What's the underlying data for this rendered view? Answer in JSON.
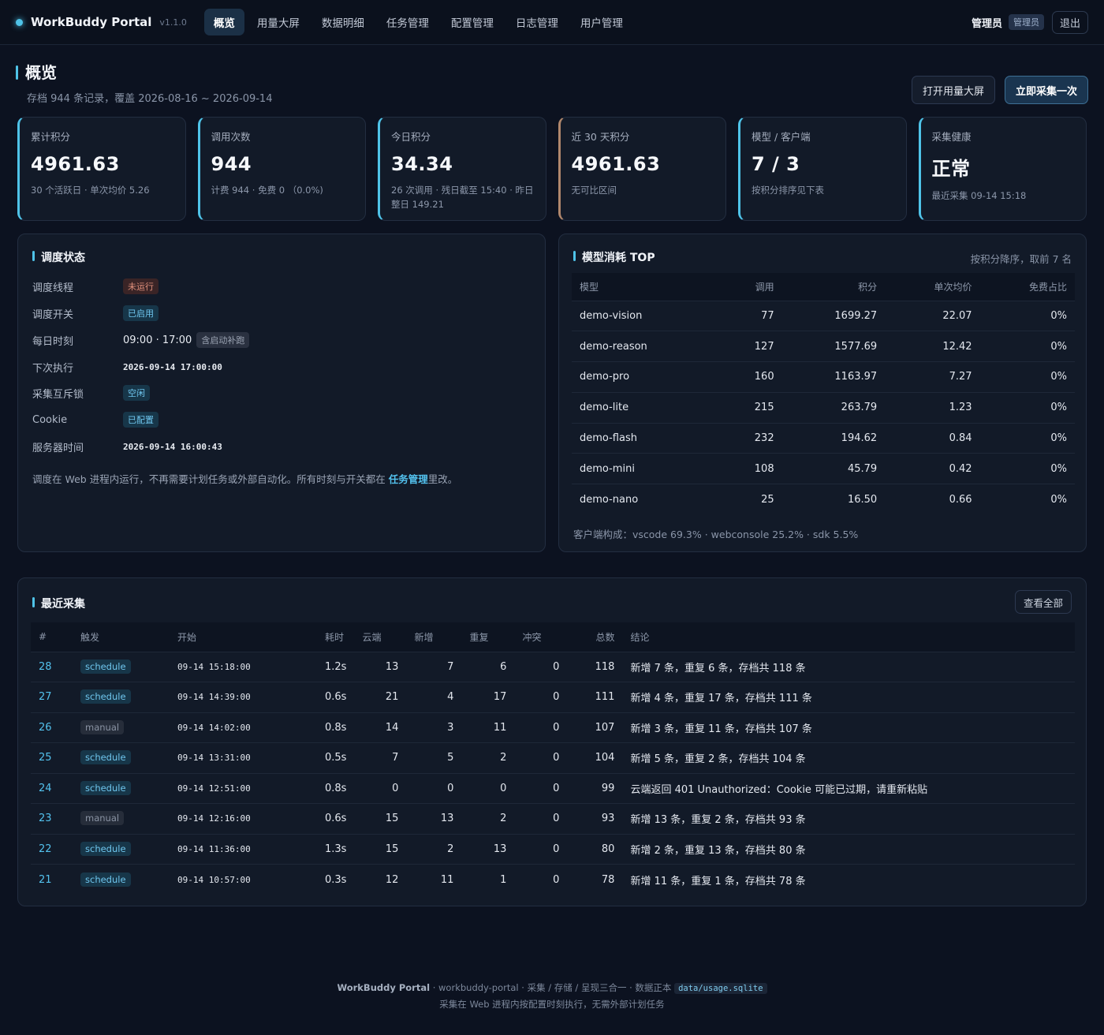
{
  "nav": {
    "brand": "WorkBuddy Portal",
    "version": "v1.1.0",
    "tabs": [
      "概览",
      "用量大屏",
      "数据明细",
      "任务管理",
      "配置管理",
      "日志管理",
      "用户管理"
    ],
    "user": "管理员",
    "role": "管理员",
    "logout": "退出"
  },
  "header": {
    "title": "概览",
    "subtitle": "存档 944 条记录，覆盖 2026-08-16 ~ 2026-09-14",
    "btn_screen": "打开用量大屏",
    "btn_collect": "立即采集一次"
  },
  "kpis": [
    {
      "label": "累计积分",
      "value": "4961.63",
      "foot": "30 个活跃日 · 单次均价 5.26"
    },
    {
      "label": "调用次数",
      "value": "944",
      "foot": "计费 944 · 免费 0 （0.0%)"
    },
    {
      "label": "今日积分",
      "value": "34.34",
      "foot": "26 次调用 · 残日截至 15:40 · 昨日整日 149.21"
    },
    {
      "label": "近 30 天积分",
      "value": "4961.63",
      "foot": "无可比区间"
    },
    {
      "label": "模型 / 客户端",
      "value": "7 / 3",
      "foot": "按积分排序见下表"
    },
    {
      "label": "采集健康",
      "value": "正常",
      "foot": "最近采集 09-14 15:18"
    }
  ],
  "schedule": {
    "title": "调度状态",
    "rows": {
      "thread": {
        "key": "调度线程",
        "tag": "未运行"
      },
      "switch": {
        "key": "调度开关",
        "tag": "已启用"
      },
      "daily": {
        "key": "每日时刻",
        "value": "09:00 · 17:00",
        "tag": "含启动补跑"
      },
      "next": {
        "key": "下次执行",
        "value": "2026-09-14 17:00:00"
      },
      "lock": {
        "key": "采集互斥锁",
        "tag": "空闲"
      },
      "cookie": {
        "key": "Cookie",
        "tag": "已配置"
      },
      "server_time": {
        "key": "服务器时间",
        "value": "2026-09-14 16:00:43"
      }
    },
    "note_prefix": "调度在 Web 进程内运行，不再需要计划任务或外部自动化。所有时刻与开关都在 ",
    "note_link": "任务管理",
    "note_suffix": "里改。"
  },
  "models": {
    "title": "模型消耗 TOP",
    "hint": "按积分降序，取前 7 名",
    "headers": [
      "模型",
      "调用",
      "积分",
      "单次均价",
      "免费占比"
    ],
    "rows": [
      [
        "demo-vision",
        "77",
        "1699.27",
        "22.07",
        "0%"
      ],
      [
        "demo-reason",
        "127",
        "1577.69",
        "12.42",
        "0%"
      ],
      [
        "demo-pro",
        "160",
        "1163.97",
        "7.27",
        "0%"
      ],
      [
        "demo-lite",
        "215",
        "263.79",
        "1.23",
        "0%"
      ],
      [
        "demo-flash",
        "232",
        "194.62",
        "0.84",
        "0%"
      ],
      [
        "demo-mini",
        "108",
        "45.79",
        "0.42",
        "0%"
      ],
      [
        "demo-nano",
        "25",
        "16.50",
        "0.66",
        "0%"
      ]
    ],
    "client_mix": "客户端构成：vscode 69.3% · webconsole 25.2% · sdk 5.5%"
  },
  "recent": {
    "title": "最近采集",
    "view_all": "查看全部",
    "headers": [
      "#",
      "触发",
      "开始",
      "耗时",
      "云端",
      "新增",
      "重复",
      "冲突",
      "总数",
      "结论"
    ],
    "rows": [
      [
        "28",
        "schedule",
        "09-14 15:18:00",
        "1.2s",
        "13",
        "7",
        "6",
        "0",
        "118",
        "新增 7 条，重复 6 条，存档共 118 条"
      ],
      [
        "27",
        "schedule",
        "09-14 14:39:00",
        "0.6s",
        "21",
        "4",
        "17",
        "0",
        "111",
        "新增 4 条，重复 17 条，存档共 111 条"
      ],
      [
        "26",
        "manual",
        "09-14 14:02:00",
        "0.8s",
        "14",
        "3",
        "11",
        "0",
        "107",
        "新增 3 条，重复 11 条，存档共 107 条"
      ],
      [
        "25",
        "schedule",
        "09-14 13:31:00",
        "0.5s",
        "7",
        "5",
        "2",
        "0",
        "104",
        "新增 5 条，重复 2 条，存档共 104 条"
      ],
      [
        "24",
        "schedule",
        "09-14 12:51:00",
        "0.8s",
        "0",
        "0",
        "0",
        "0",
        "99",
        "云端返回 401 Unauthorized：Cookie 可能已过期，请重新粘贴"
      ],
      [
        "23",
        "manual",
        "09-14 12:16:00",
        "0.6s",
        "15",
        "13",
        "2",
        "0",
        "93",
        "新增 13 条，重复 2 条，存档共 93 条"
      ],
      [
        "22",
        "schedule",
        "09-14 11:36:00",
        "1.3s",
        "15",
        "2",
        "13",
        "0",
        "80",
        "新增 2 条，重复 13 条，存档共 80 条"
      ],
      [
        "21",
        "schedule",
        "09-14 10:57:00",
        "0.3s",
        "12",
        "11",
        "1",
        "0",
        "78",
        "新增 11 条，重复 1 条，存档共 78 条"
      ]
    ]
  },
  "footer": {
    "brand": "WorkBuddy Portal",
    "line1": " · workbuddy-portal · 采集 / 存储 / 呈现三合一 · 数据正本 ",
    "path": "data/usage.sqlite",
    "line2": "采集在 Web 进程内按配置时刻执行，无需外部计划任务"
  },
  "colors": {
    "accent": "#4fc3e8",
    "background": "#0c1220",
    "card": "#121a28",
    "tag_warn": "#e0907c"
  }
}
